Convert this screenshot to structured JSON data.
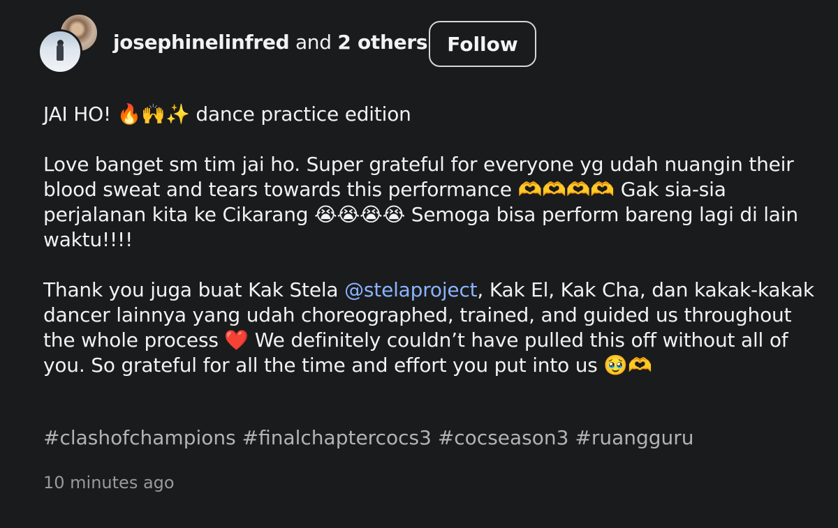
{
  "post": {
    "author": {
      "username": "josephinelinfred",
      "connector": "and",
      "others": "2 others"
    },
    "follow_label": "Follow",
    "caption": {
      "title": "JAI HO! 🔥🙌✨ dance practice edition",
      "paragraph1": "Love banget sm tim jai ho. Super grateful for everyone yg udah nuangin their blood sweat and tears towards this performance 🫶🫶🫶🫶 Gak sia-sia perjalanan kita ke Cikarang 😭😭😭😭 Semoga bisa perform bareng lagi di lain waktu!!!!",
      "paragraph2_before": "Thank you juga buat Kak Stela ",
      "mention_icon": "@",
      "mention": "stelaproject",
      "paragraph2_after": ", Kak El, Kak Cha, dan kakak-kakak dancer lainnya yang udah choreographed, trained, and guided us throughout the whole process ❤️ We definitely couldn’t have pulled this off without all of you. So grateful for all the time and effort you put into us 🥹🫶"
    },
    "hashtags": [
      "#clashofchampions",
      "#finalchaptercocs3",
      "#cocseason3",
      "#ruangguru"
    ],
    "timestamp": "10 minutes ago"
  },
  "colors": {
    "background": "#1a1b1d",
    "text": "#f2f2f2",
    "mention": "#8ab4ff",
    "hashtag": "#b3b3b3",
    "timestamp": "#9a9a9a"
  }
}
